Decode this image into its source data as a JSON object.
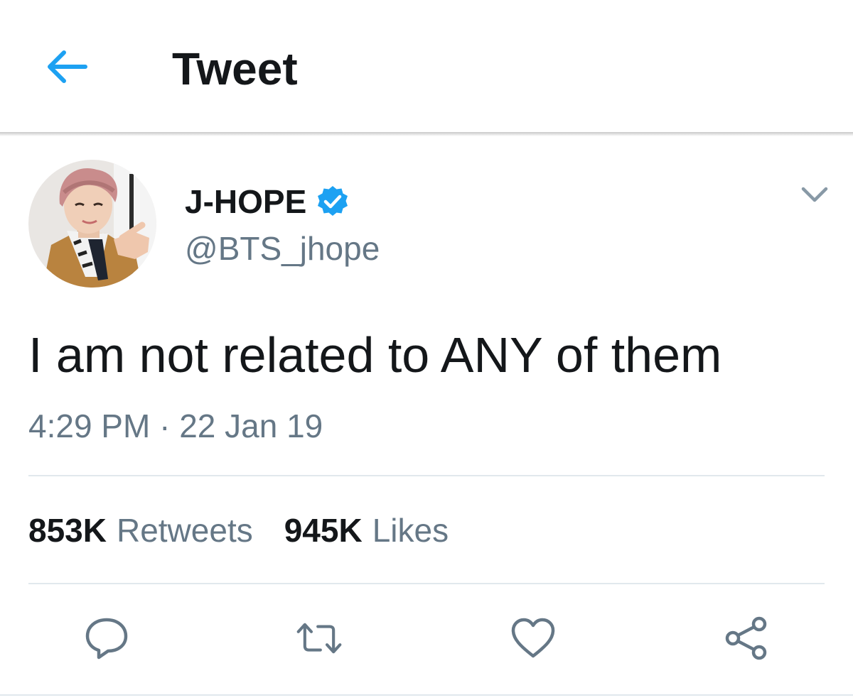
{
  "header": {
    "title": "Tweet",
    "back_icon": "back-arrow-icon"
  },
  "tweet": {
    "author": {
      "display_name": "J-HOPE",
      "handle": "@BTS_jhope",
      "verified": true
    },
    "text": "I am not related to ANY of them",
    "timestamp": "4:29 PM · 22 Jan 19",
    "stats": {
      "retweets_count": "853K",
      "retweets_label": "Retweets",
      "likes_count": "945K",
      "likes_label": "Likes"
    },
    "actions": [
      "reply-icon",
      "retweet-icon",
      "like-icon",
      "share-icon"
    ]
  },
  "colors": {
    "accent": "#1da1f2",
    "text_primary": "#14171a",
    "text_secondary": "#657786",
    "divider": "#e1e8ed"
  }
}
